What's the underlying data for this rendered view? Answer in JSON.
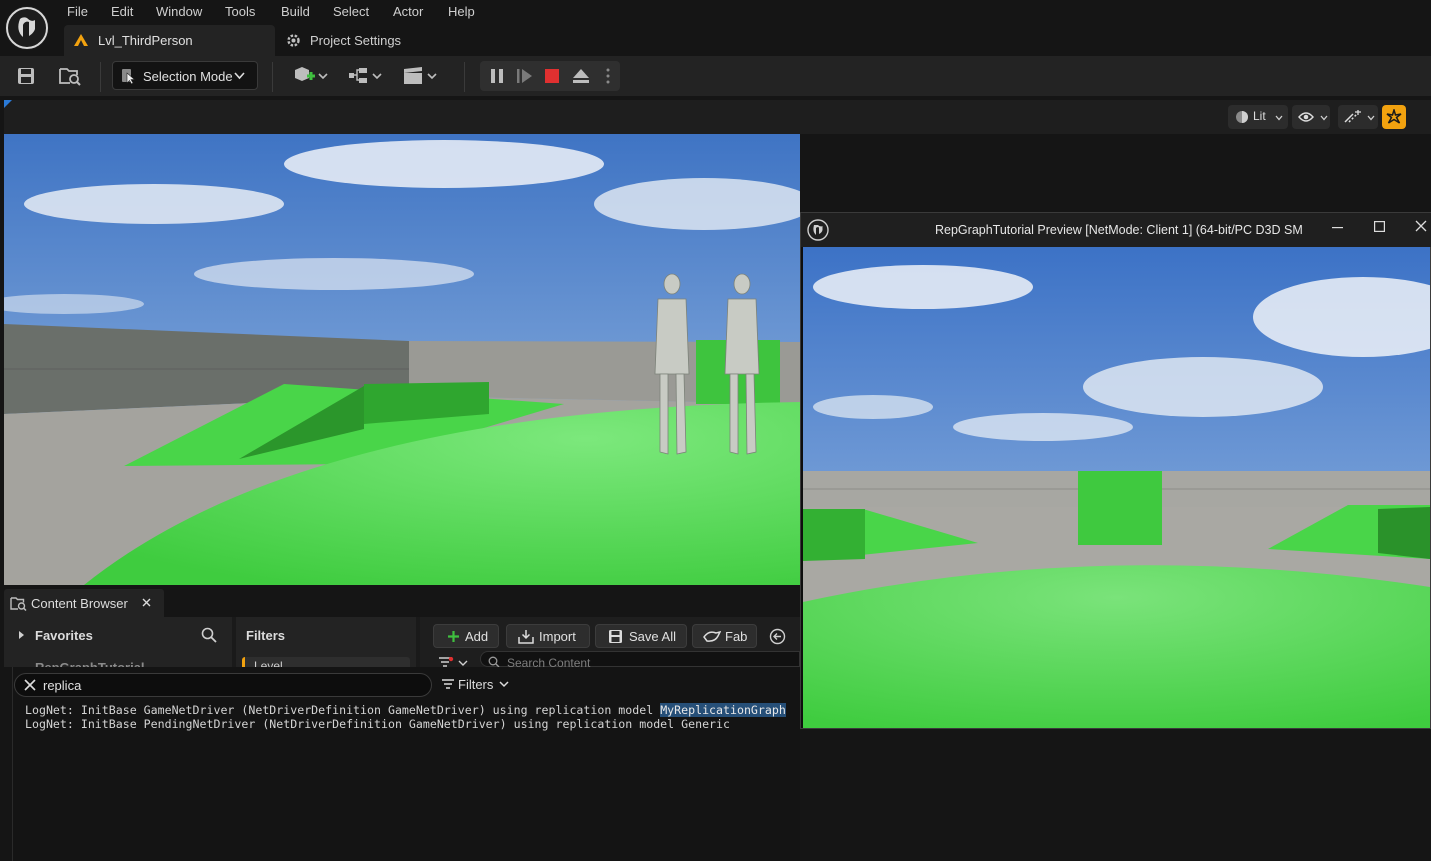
{
  "menu": {
    "items": [
      "File",
      "Edit",
      "Window",
      "Tools",
      "Build",
      "Select",
      "Actor",
      "Help"
    ]
  },
  "tabs": {
    "level": "Lvl_ThirdPerson",
    "project_settings": "Project Settings"
  },
  "toolbar": {
    "selection_mode": "Selection Mode"
  },
  "viewport": {
    "lit_label": "Lit"
  },
  "pie_window": {
    "title": "RepGraphTutorial Preview [NetMode: Client 1]  (64-bit/PC D3D SM"
  },
  "content_browser": {
    "tab_label": "Content Browser",
    "favorites_label": "Favorites",
    "filters_label": "Filters",
    "folder_partial": "RepGraphTutorial",
    "level_filter_partial": "Level",
    "add_label": "Add",
    "import_label": "Import",
    "save_all_label": "Save All",
    "fab_label": "Fab",
    "search_placeholder": "Search Content"
  },
  "output_log": {
    "search_value": "replica",
    "filters_label": "Filters",
    "line1_prefix": "LogNet: InitBase GameNetDriver (NetDriverDefinition GameNetDriver) using replication model ",
    "line1_highlight": "MyReplicationGraph",
    "line2": "LogNet: InitBase PendingNetDriver (NetDriverDefinition GameNetDriver) using replication model Generic"
  },
  "colors": {
    "accent_orange": "#f2a20f",
    "stop_red": "#e03030",
    "highlight_blue": "#264f78",
    "floor_green": "#49d549"
  }
}
